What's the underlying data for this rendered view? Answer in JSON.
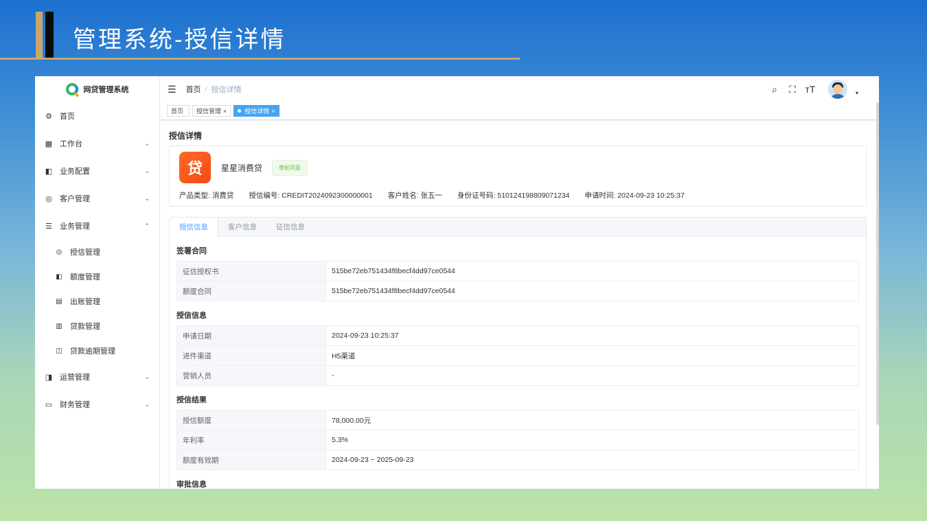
{
  "slide": {
    "title": "管理系统-授信详情"
  },
  "brand": {
    "name": "网贷管理系统"
  },
  "sidebar": {
    "items": [
      {
        "label": "首页",
        "icon": "dashboard-icon",
        "glyph": "⚙",
        "chevron": ""
      },
      {
        "label": "工作台",
        "icon": "grid-icon",
        "glyph": "▦",
        "chevron": "⌄"
      },
      {
        "label": "业务配置",
        "icon": "book-icon",
        "glyph": "◧",
        "chevron": "⌄"
      },
      {
        "label": "客户管理",
        "icon": "lifebuoy-icon",
        "glyph": "◎",
        "chevron": "⌄"
      },
      {
        "label": "业务管理",
        "icon": "sliders-icon",
        "glyph": "☰",
        "chevron": "⌃"
      }
    ],
    "sub_items": [
      {
        "label": "授信管理",
        "glyph": "◎"
      },
      {
        "label": "额度管理",
        "glyph": "◧"
      },
      {
        "label": "出账管理",
        "glyph": "▤"
      },
      {
        "label": "贷款管理",
        "glyph": "▥"
      },
      {
        "label": "贷款逾期管理",
        "glyph": "◫"
      }
    ],
    "items_after": [
      {
        "label": "运营管理",
        "glyph": "◨",
        "chevron": "⌄"
      },
      {
        "label": "财务管理",
        "glyph": "▭",
        "chevron": "⌄"
      }
    ]
  },
  "breadcrumb": {
    "home": "首页",
    "sep": "/",
    "current": "授信详情"
  },
  "tags": [
    {
      "label": "首页",
      "closable": ""
    },
    {
      "label": "授信管理",
      "closable": "×"
    },
    {
      "label": "授信详情",
      "closable": "×"
    }
  ],
  "page": {
    "title": "授信详情",
    "product": {
      "icon_text": "贷",
      "name": "星星消费贷",
      "status": "审批同意"
    },
    "meta": [
      "产品类型: 消费贷",
      "授信编号: CREDIT2024092300000001",
      "客户姓名: 张五一",
      "身份证号码: 510124198809071234",
      "申请时间: 2024-09-23 10:25:37"
    ],
    "tabs": [
      "授信信息",
      "客户信息",
      "征信信息"
    ],
    "sections": [
      {
        "title": "签署合同",
        "rows": [
          {
            "k": "征信授权书",
            "v": "515be72eb751434f8becf4dd97ce0544"
          },
          {
            "k": "额度合同",
            "v": "515be72eb751434f8becf4dd97ce0544"
          }
        ]
      },
      {
        "title": "授信信息",
        "rows": [
          {
            "k": "申请日期",
            "v": "2024-09-23 10:25:37"
          },
          {
            "k": "进件渠道",
            "v": "H5渠道"
          },
          {
            "k": "营销人员",
            "v": "-"
          }
        ]
      },
      {
        "title": "授信结果",
        "rows": [
          {
            "k": "授信额度",
            "v": "78,000.00元"
          },
          {
            "k": "年利率",
            "v": "5.3%"
          },
          {
            "k": "额度有效期",
            "v": "2024-09-23 ~ 2025-09-23"
          }
        ]
      },
      {
        "title": "审批信息",
        "rows": []
      }
    ]
  }
}
